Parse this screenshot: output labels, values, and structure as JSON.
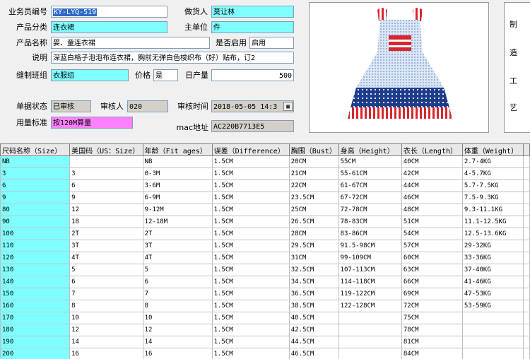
{
  "form": {
    "salesman_no_label": "业务员编号",
    "salesman_no": "KY-LYQ-519",
    "maker_label": "做货人",
    "maker": "莫让林",
    "category_label": "产品分类",
    "category": "连衣裙",
    "unit_label": "主单位",
    "unit": "件",
    "name_label": "产品名称",
    "name": "婴、童连衣裙",
    "enabled_label": "是否启用",
    "enabled": "启用",
    "desc_label": "说明",
    "desc": "深蓝白格子泡泡布连衣裙，胸前无弹白色梭织布（好）贴布，订2",
    "group_label": "缝制班组",
    "group": "衣服组",
    "price_label": "价格",
    "price": "是",
    "daily_label": "日产量",
    "daily": "500",
    "status_label": "单据状态",
    "status": "已审核",
    "reviewer_label": "审核人",
    "reviewer": "020",
    "review_time_label": "审核时间",
    "review_time": "2018-05-05  14:3",
    "usage_label": "用量标准",
    "usage": "按120M算量",
    "mac_label": "mac地址",
    "mac": "AC220B7713E5"
  },
  "process": [
    "制",
    "造",
    "工",
    "艺"
  ],
  "grid": {
    "headers": [
      "尺码名称（Size）",
      "美国码（US：Size）",
      "年龄（Fit ages）",
      "误差（Difference）",
      "胸围（Bust）",
      "身高（Height）",
      "衣长（Length）",
      "体重（Weight）"
    ],
    "rows": [
      [
        "NB",
        "",
        "NB",
        "1.5CM",
        "20CM",
        "55CM",
        "40CM",
        "2.7-4KG"
      ],
      [
        "3",
        "3",
        "0-3M",
        "1.5CM",
        "21CM",
        "55-61CM",
        "42CM",
        "4-5.7KG"
      ],
      [
        "6",
        "6",
        "3-6M",
        "1.5CM",
        "22CM",
        "61-67CM",
        "44CM",
        "5.7-7.5KG"
      ],
      [
        "9",
        "9",
        "6-9M",
        "1.5CM",
        "23.5CM",
        "67-72CM",
        "46CM",
        "7.5-9.3KG"
      ],
      [
        "80",
        "12",
        "9-12M",
        "1.5CM",
        "25CM",
        "72-78CM",
        "48CM",
        "9.3-11.1KG"
      ],
      [
        "90",
        "18",
        "12-18M",
        "1.5CM",
        "26.5CM",
        "78-83CM",
        "51CM",
        "11.1-12.5KG"
      ],
      [
        "100",
        "2T",
        "2T",
        "1.5CM",
        "28CM",
        "83-86CM",
        "54CM",
        "12.5-13.6KG"
      ],
      [
        "110",
        "3T",
        "3T",
        "1.5CM",
        "29.5CM",
        "91.5-98CM",
        "57CM",
        "29-32KG"
      ],
      [
        "120",
        "4T",
        "4T",
        "1.5CM",
        "31CM",
        "99-109CM",
        "60CM",
        "33-36KG"
      ],
      [
        "130",
        "5",
        "5",
        "1.5CM",
        "32.5CM",
        "107-113CM",
        "63CM",
        "37-40KG"
      ],
      [
        "140",
        "6",
        "6",
        "1.5CM",
        "34.5CM",
        "114-118CM",
        "66CM",
        "41-46KG"
      ],
      [
        "150",
        "7",
        "7",
        "1.5CM",
        "36.5CM",
        "119-122CM",
        "69CM",
        "47-53KG"
      ],
      [
        "160",
        "8",
        "8",
        "1.5CM",
        "38.5CM",
        "122-128CM",
        "72CM",
        "53-59KG"
      ],
      [
        "170",
        "10",
        "10",
        "1.5CM",
        "40.5CM",
        "",
        "75CM",
        ""
      ],
      [
        "180",
        "12",
        "12",
        "1.5CM",
        "42.5CM",
        "",
        "78CM",
        ""
      ],
      [
        "190",
        "14",
        "14",
        "1.5CM",
        "44.5CM",
        "",
        "81CM",
        ""
      ],
      [
        "200",
        "16",
        "16",
        "1.5CM",
        "46.5CM",
        "",
        "84CM",
        ""
      ]
    ]
  }
}
